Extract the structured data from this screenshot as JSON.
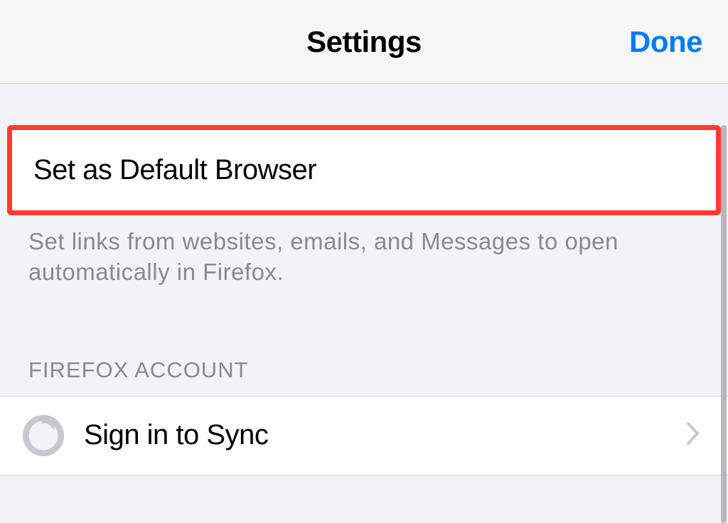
{
  "header": {
    "title": "Settings",
    "done_label": "Done"
  },
  "default_browser": {
    "label": "Set as Default Browser",
    "description": "Set links from websites, emails, and Messages to open automatically in Firefox."
  },
  "firefox_account": {
    "section_header": "FIREFOX ACCOUNT",
    "sign_in_label": "Sign in to Sync"
  }
}
